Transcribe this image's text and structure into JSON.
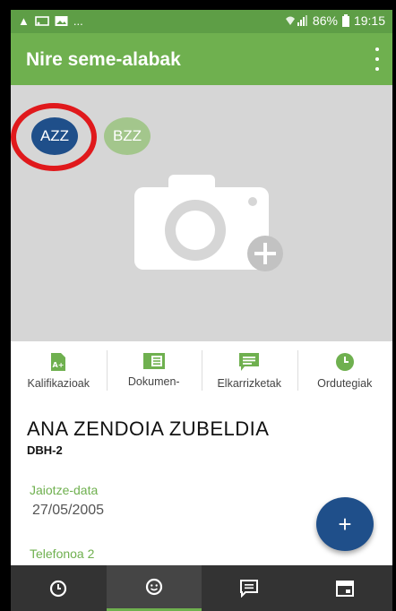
{
  "statusbar": {
    "left_icons": [
      "warning-icon",
      "cast-icon",
      "image-icon"
    ],
    "dots": "...",
    "battery": "86%",
    "time": "19:15"
  },
  "appbar": {
    "title": "Nire seme-alabak"
  },
  "children": [
    {
      "initials": "AZZ",
      "selected": true,
      "color": "#1f4f8a"
    },
    {
      "initials": "BZZ",
      "selected": false,
      "color": "#a3c68c"
    }
  ],
  "tabs": [
    {
      "label": "Kalifikazioak",
      "icon": "grade-file-icon"
    },
    {
      "label": "Dokumen-",
      "icon": "document-icon"
    },
    {
      "label": "Elkarrizketak",
      "icon": "message-icon"
    },
    {
      "label": "Ordutegiak",
      "icon": "clock-icon"
    }
  ],
  "student": {
    "name": "ANA ZENDOIA ZUBELDIA",
    "grade": "DBH-2",
    "birth_label": "Jaiotze-data",
    "birth_value": "27/05/2005",
    "phone_label": "Telefonoa 2"
  },
  "fab": {
    "label": "+"
  },
  "bottomnav": [
    {
      "icon": "history-icon",
      "active": false
    },
    {
      "icon": "face-icon",
      "active": true
    },
    {
      "icon": "chat-icon",
      "active": false
    },
    {
      "icon": "calendar-icon",
      "active": false
    }
  ],
  "colors": {
    "primary": "#6fb04f",
    "accent": "#1f4f8a",
    "highlight": "#e0191c"
  }
}
